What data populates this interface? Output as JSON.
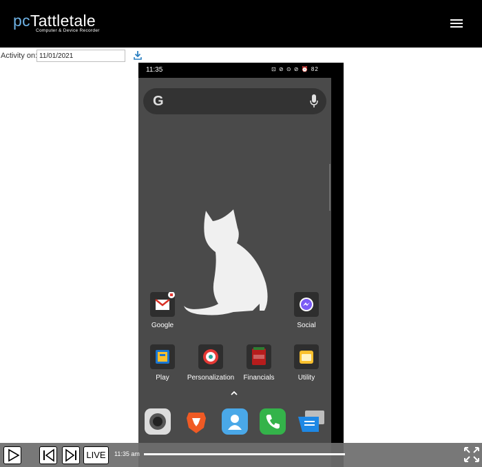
{
  "header": {
    "logo_prefix": "pc",
    "logo_main": "Tattletale",
    "logo_tagline": "Computer & Device Recorder"
  },
  "activity": {
    "label": "Activity on:",
    "date_value": "11/01/2021"
  },
  "phone": {
    "status_time": "11:35",
    "status_right": "⊡ ⊘ ⊙ ⊘ ⏰ 82",
    "search_logo": "G",
    "apps": [
      {
        "label": "Google"
      },
      {
        "label": "Social"
      },
      {
        "label": "Play"
      },
      {
        "label": "Personalization"
      },
      {
        "label": "Financials"
      },
      {
        "label": "Utility"
      }
    ],
    "dock": [
      "camera-icon",
      "brave-browser-icon",
      "contacts-icon",
      "phone-icon",
      "messages-icon"
    ],
    "colors": {
      "screen": "#4a4a4a",
      "phone_green": "#34b34a",
      "contacts_blue": "#4aa8e8",
      "brave_orange": "#f05a24"
    }
  },
  "player": {
    "live_label": "LIVE",
    "time": "11:35 am",
    "progress_fraction": 1.0
  }
}
